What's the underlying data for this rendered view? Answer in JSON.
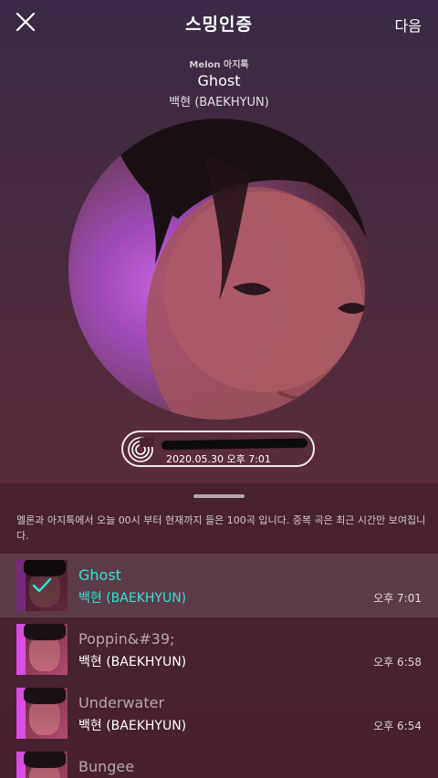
{
  "header": {
    "title": "스밍인증",
    "next_label": "다음",
    "close_icon": "close-icon"
  },
  "now_playing": {
    "brand": "Melon 아지톡",
    "title": "Ghost",
    "artist": "백현 (BAEKHYUN)"
  },
  "timestamp": {
    "text": "2020.05.30 오후 7:01"
  },
  "list": {
    "notice": "멜론과 아지톡에서 오늘 00시 부터 현재까지 들은 100곡 입니다. 중복 곡은 최근 시간만 보여집니다.",
    "items": [
      {
        "title": "Ghost",
        "artist": "백현 (BAEKHYUN)",
        "time": "오후 7:01",
        "selected": true
      },
      {
        "title": "Poppin&#39;",
        "artist": "백현 (BAEKHYUN)",
        "time": "오후 6:58",
        "selected": false
      },
      {
        "title": "Underwater",
        "artist": "백현 (BAEKHYUN)",
        "time": "오후 6:54",
        "selected": false
      },
      {
        "title": "Bungee",
        "artist": "",
        "time": "",
        "selected": false
      }
    ]
  },
  "colors": {
    "accent": "#2fe4d6",
    "background": "#4a2a3e"
  }
}
